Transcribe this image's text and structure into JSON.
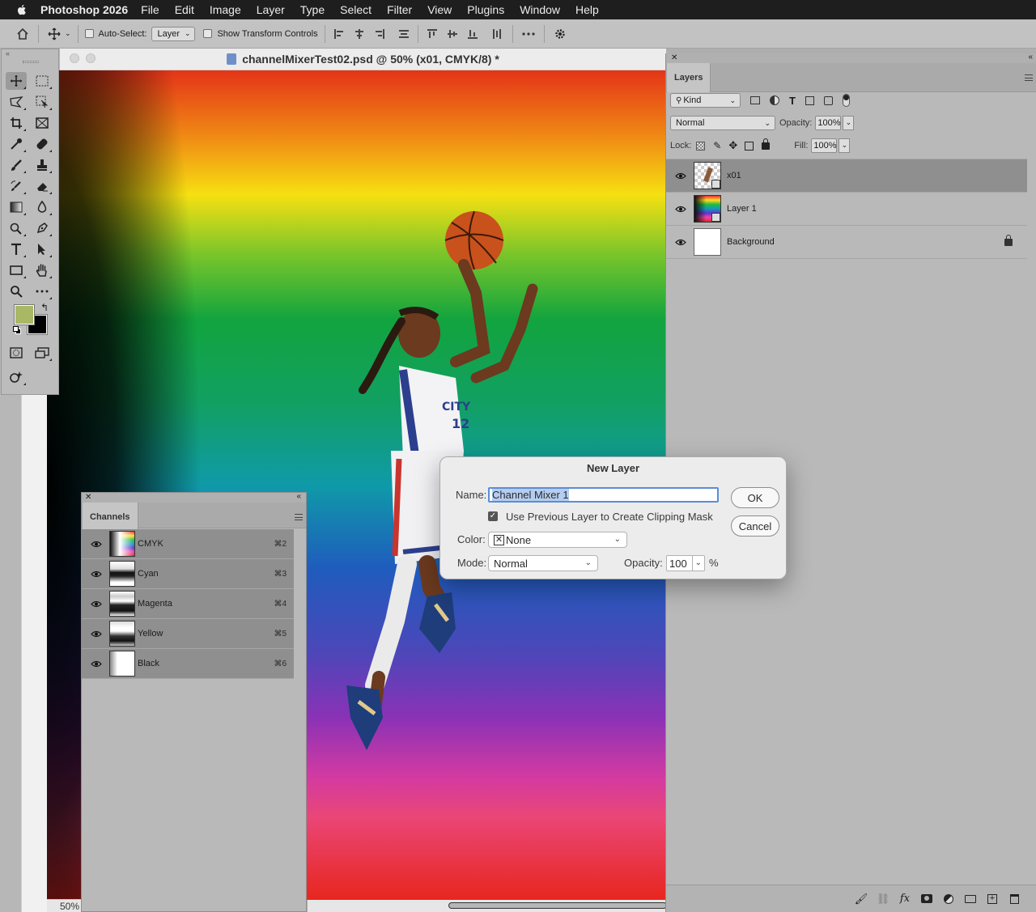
{
  "menubar": {
    "app_name": "Photoshop 2026",
    "items": [
      "File",
      "Edit",
      "Image",
      "Layer",
      "Type",
      "Select",
      "Filter",
      "View",
      "Plugins",
      "Window",
      "Help"
    ]
  },
  "options_bar": {
    "auto_select_label": "Auto-Select:",
    "auto_select_checked": false,
    "auto_select_target": "Layer",
    "show_transform_label": "Show Transform Controls",
    "show_transform_checked": false
  },
  "document": {
    "title": "channelMixerTest02.psd @ 50% (x01, CMYK/8) *",
    "zoom": "50%"
  },
  "tools": {
    "foreground_color": "#a8b864",
    "background_color": "#000000"
  },
  "layers_panel": {
    "tab_label": "Layers",
    "filter_kind": "Kind",
    "blend_mode": "Normal",
    "opacity_label": "Opacity:",
    "opacity_value": "100%",
    "lock_label": "Lock:",
    "fill_label": "Fill:",
    "fill_value": "100%",
    "layers": [
      {
        "name": "x01",
        "visible": true,
        "selected": true
      },
      {
        "name": "Layer 1",
        "visible": true,
        "selected": false
      },
      {
        "name": "Background",
        "visible": true,
        "selected": false,
        "locked": true
      }
    ]
  },
  "channels_panel": {
    "tab_label": "Channels",
    "channels": [
      {
        "name": "CMYK",
        "shortcut": "⌘2"
      },
      {
        "name": "Cyan",
        "shortcut": "⌘3"
      },
      {
        "name": "Magenta",
        "shortcut": "⌘4"
      },
      {
        "name": "Yellow",
        "shortcut": "⌘5"
      },
      {
        "name": "Black",
        "shortcut": "⌘6"
      }
    ]
  },
  "dialog": {
    "title": "New Layer",
    "name_label": "Name:",
    "name_value": "Channel Mixer 1",
    "clip_label": "Use Previous Layer to Create Clipping Mask",
    "clip_checked": true,
    "color_label": "Color:",
    "color_value": "None",
    "mode_label": "Mode:",
    "mode_value": "Normal",
    "opacity_label": "Opacity:",
    "opacity_value": "100",
    "opacity_unit": "%",
    "ok_label": "OK",
    "cancel_label": "Cancel"
  }
}
